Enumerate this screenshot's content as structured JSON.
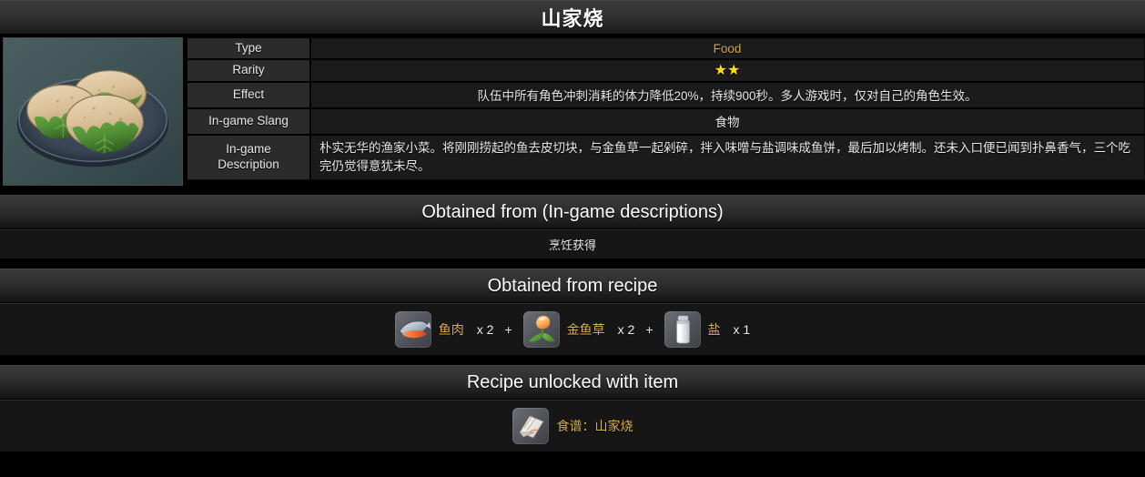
{
  "header": {
    "title": "山家烧"
  },
  "item": {
    "image_alt": "山家烧 dish: grilled fish cakes on shiso leaves on a dark plate"
  },
  "info_table": {
    "rows": [
      {
        "label": "Type",
        "value": "Food",
        "style": "gold"
      },
      {
        "label": "Rarity",
        "value": "★★",
        "stars": 2,
        "style": "stars"
      },
      {
        "label": "Effect",
        "value": "队伍中所有角色冲刺消耗的体力降低20%，持续900秒。多人游戏时，仅对自己的角色生效。",
        "style": "plain"
      },
      {
        "label": "In-game Slang",
        "value": "食物",
        "style": "plain"
      },
      {
        "label": "In-game Description",
        "value": "朴实无华的渔家小菜。将刚刚捞起的鱼去皮切块，与金鱼草一起剁碎，拌入味噌与盐调味成鱼饼，最后加以烤制。还未入口便已闻到扑鼻香气，三个吃完仍觉得意犹未尽。",
        "style": "desc"
      }
    ]
  },
  "sections": {
    "obtained_from": {
      "title": "Obtained from (In-game descriptions)",
      "text": "烹饪获得"
    },
    "obtained_from_recipe": {
      "title": "Obtained from recipe",
      "ingredients": [
        {
          "icon": "fish-meat-icon",
          "name": "鱼肉",
          "qty": "x 2"
        },
        {
          "icon": "snapdragon-icon",
          "name": "金鱼草",
          "qty": "x 2"
        },
        {
          "icon": "salt-icon",
          "name": "盐",
          "qty": "x 1"
        }
      ],
      "separator": "+"
    },
    "recipe_unlocked": {
      "title": "Recipe unlocked with item",
      "item": {
        "icon": "recipe-book-icon",
        "name": "食谱：山家烧"
      }
    }
  },
  "colors": {
    "accent_gold": "#dcb04a",
    "star_yellow": "#ffe000",
    "background": "#000000",
    "panel": "#1b1b1b",
    "label_cell": "#2b2b2b"
  }
}
